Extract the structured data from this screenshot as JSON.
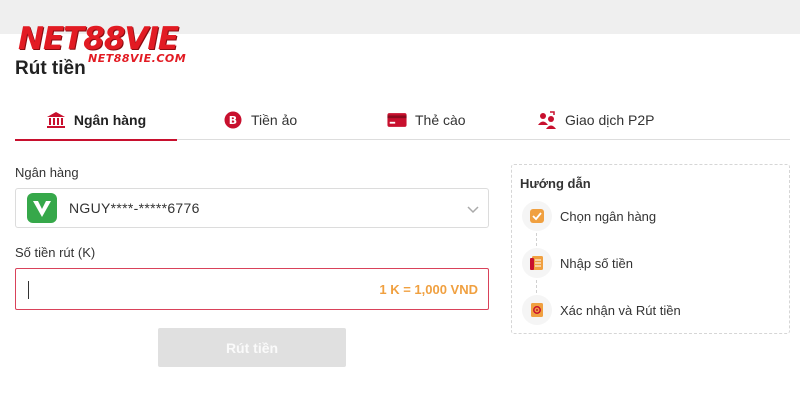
{
  "brand": {
    "name": "NET88VIE",
    "sub": "NET88VIE.COM",
    "color": "#e21b23"
  },
  "page": {
    "title": "Rút tiền"
  },
  "tabs": [
    {
      "label": "Ngân hàng",
      "icon": "bank-icon",
      "active": true
    },
    {
      "label": "Tiền ảo",
      "icon": "bitcoin-icon",
      "active": false
    },
    {
      "label": "Thẻ cào",
      "icon": "card-icon",
      "active": false
    },
    {
      "label": "Giao dịch P2P",
      "icon": "p2p-users-icon",
      "active": false
    }
  ],
  "bank": {
    "label": "Ngân hàng",
    "selected": "NGUY****-*****6776",
    "icon": "vietcombank-logo-icon"
  },
  "amount": {
    "label": "Số tiền rút (K)",
    "value": "",
    "rate_hint": "1 K = 1,000 VND"
  },
  "submit": {
    "label": "Rút tiền"
  },
  "guide": {
    "title": "Hướng dẫn",
    "steps": [
      {
        "label": "Chọn ngân hàng",
        "icon": "check-icon"
      },
      {
        "label": "Nhập số tiền",
        "icon": "document-icon"
      },
      {
        "label": "Xác nhận và Rút tiền",
        "icon": "confirm-icon"
      }
    ]
  },
  "colors": {
    "accent": "#c8102e",
    "hint": "#f0a040",
    "disabled": "#e0e0e0"
  }
}
